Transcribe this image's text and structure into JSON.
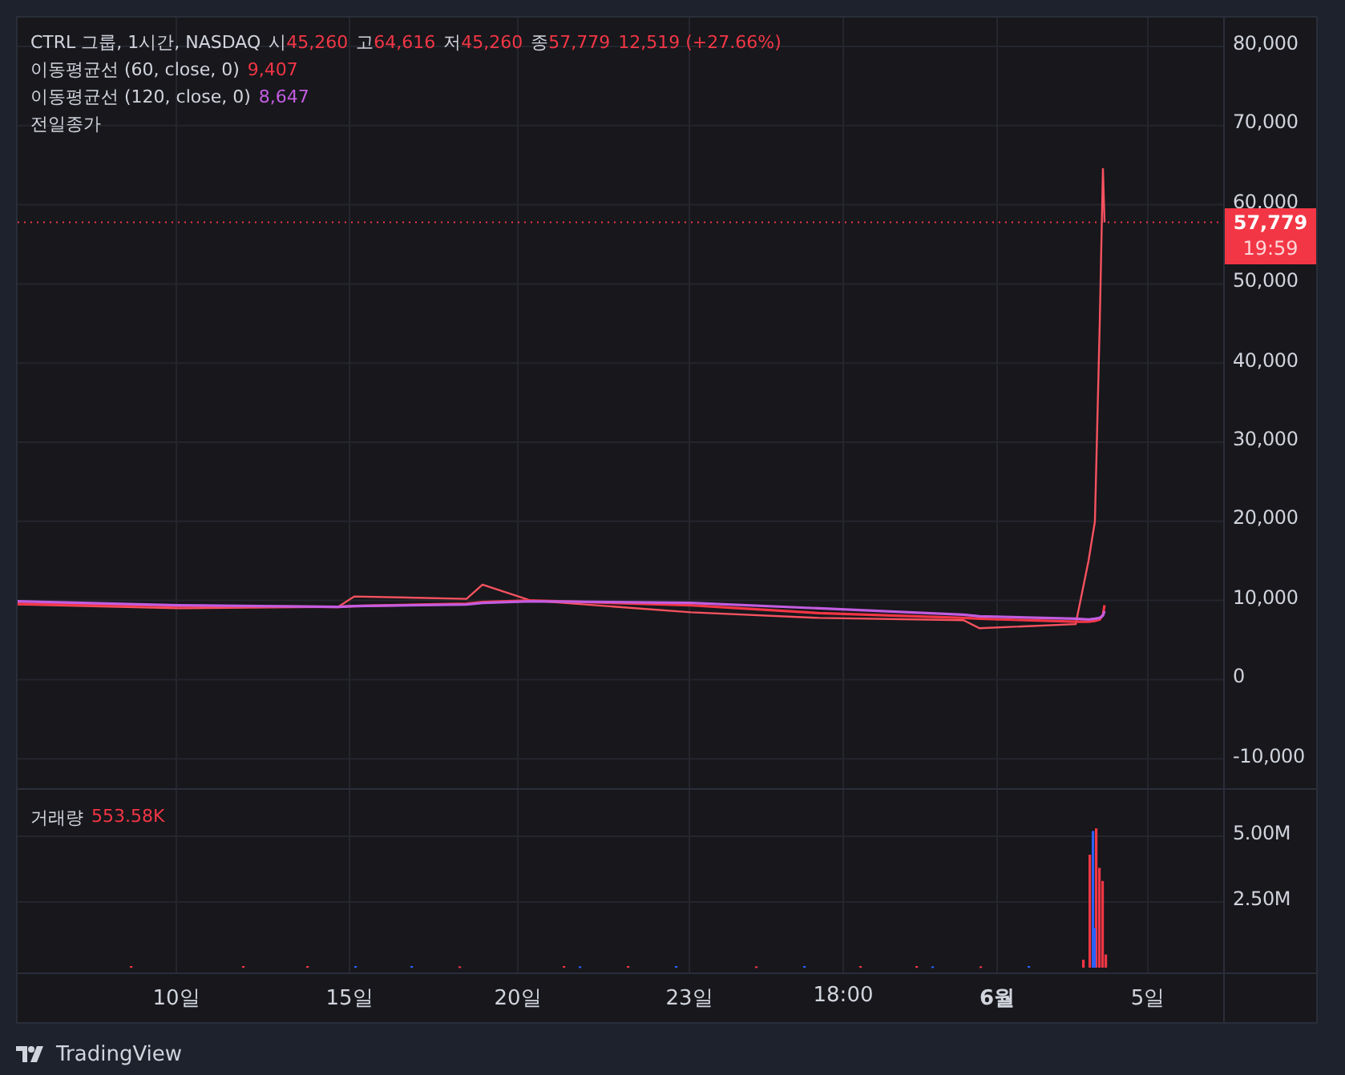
{
  "legend": {
    "symbol": "CTRL 그룹, 1시간, NASDAQ",
    "ohlc": [
      {
        "label": "시",
        "value": "45,260"
      },
      {
        "label": "고",
        "value": "64,616"
      },
      {
        "label": "저",
        "value": "45,260"
      },
      {
        "label": "종",
        "value": "57,779"
      }
    ],
    "change": "12,519 (+27.66%)",
    "indicators": [
      {
        "label": "이동평균선 (60, close, 0)",
        "value": "9,407",
        "color": "#f23645"
      },
      {
        "label": "이동평균선 (120, close, 0)",
        "value": "8,647",
        "color": "#c25de0"
      },
      {
        "label": "전일종가"
      }
    ]
  },
  "price_tag": {
    "price": "57,779",
    "countdown": "19:59"
  },
  "price_axis": [
    "80,000",
    "70,000",
    "60,000",
    "50,000",
    "40,000",
    "30,000",
    "20,000",
    "10,000",
    "0",
    "-10,000"
  ],
  "volume_pane": {
    "label": "거래량",
    "value": "553.58K"
  },
  "volume_axis": [
    "5.00M",
    "2.50M"
  ],
  "time_axis": [
    {
      "label": "10일",
      "bold": false
    },
    {
      "label": "15일",
      "bold": false
    },
    {
      "label": "20일",
      "bold": false
    },
    {
      "label": "23일",
      "bold": false
    },
    {
      "label": "18:00",
      "bold": false
    },
    {
      "label": "6월",
      "bold": true
    },
    {
      "label": "5일",
      "bold": false
    }
  ],
  "brand": "TradingView"
}
